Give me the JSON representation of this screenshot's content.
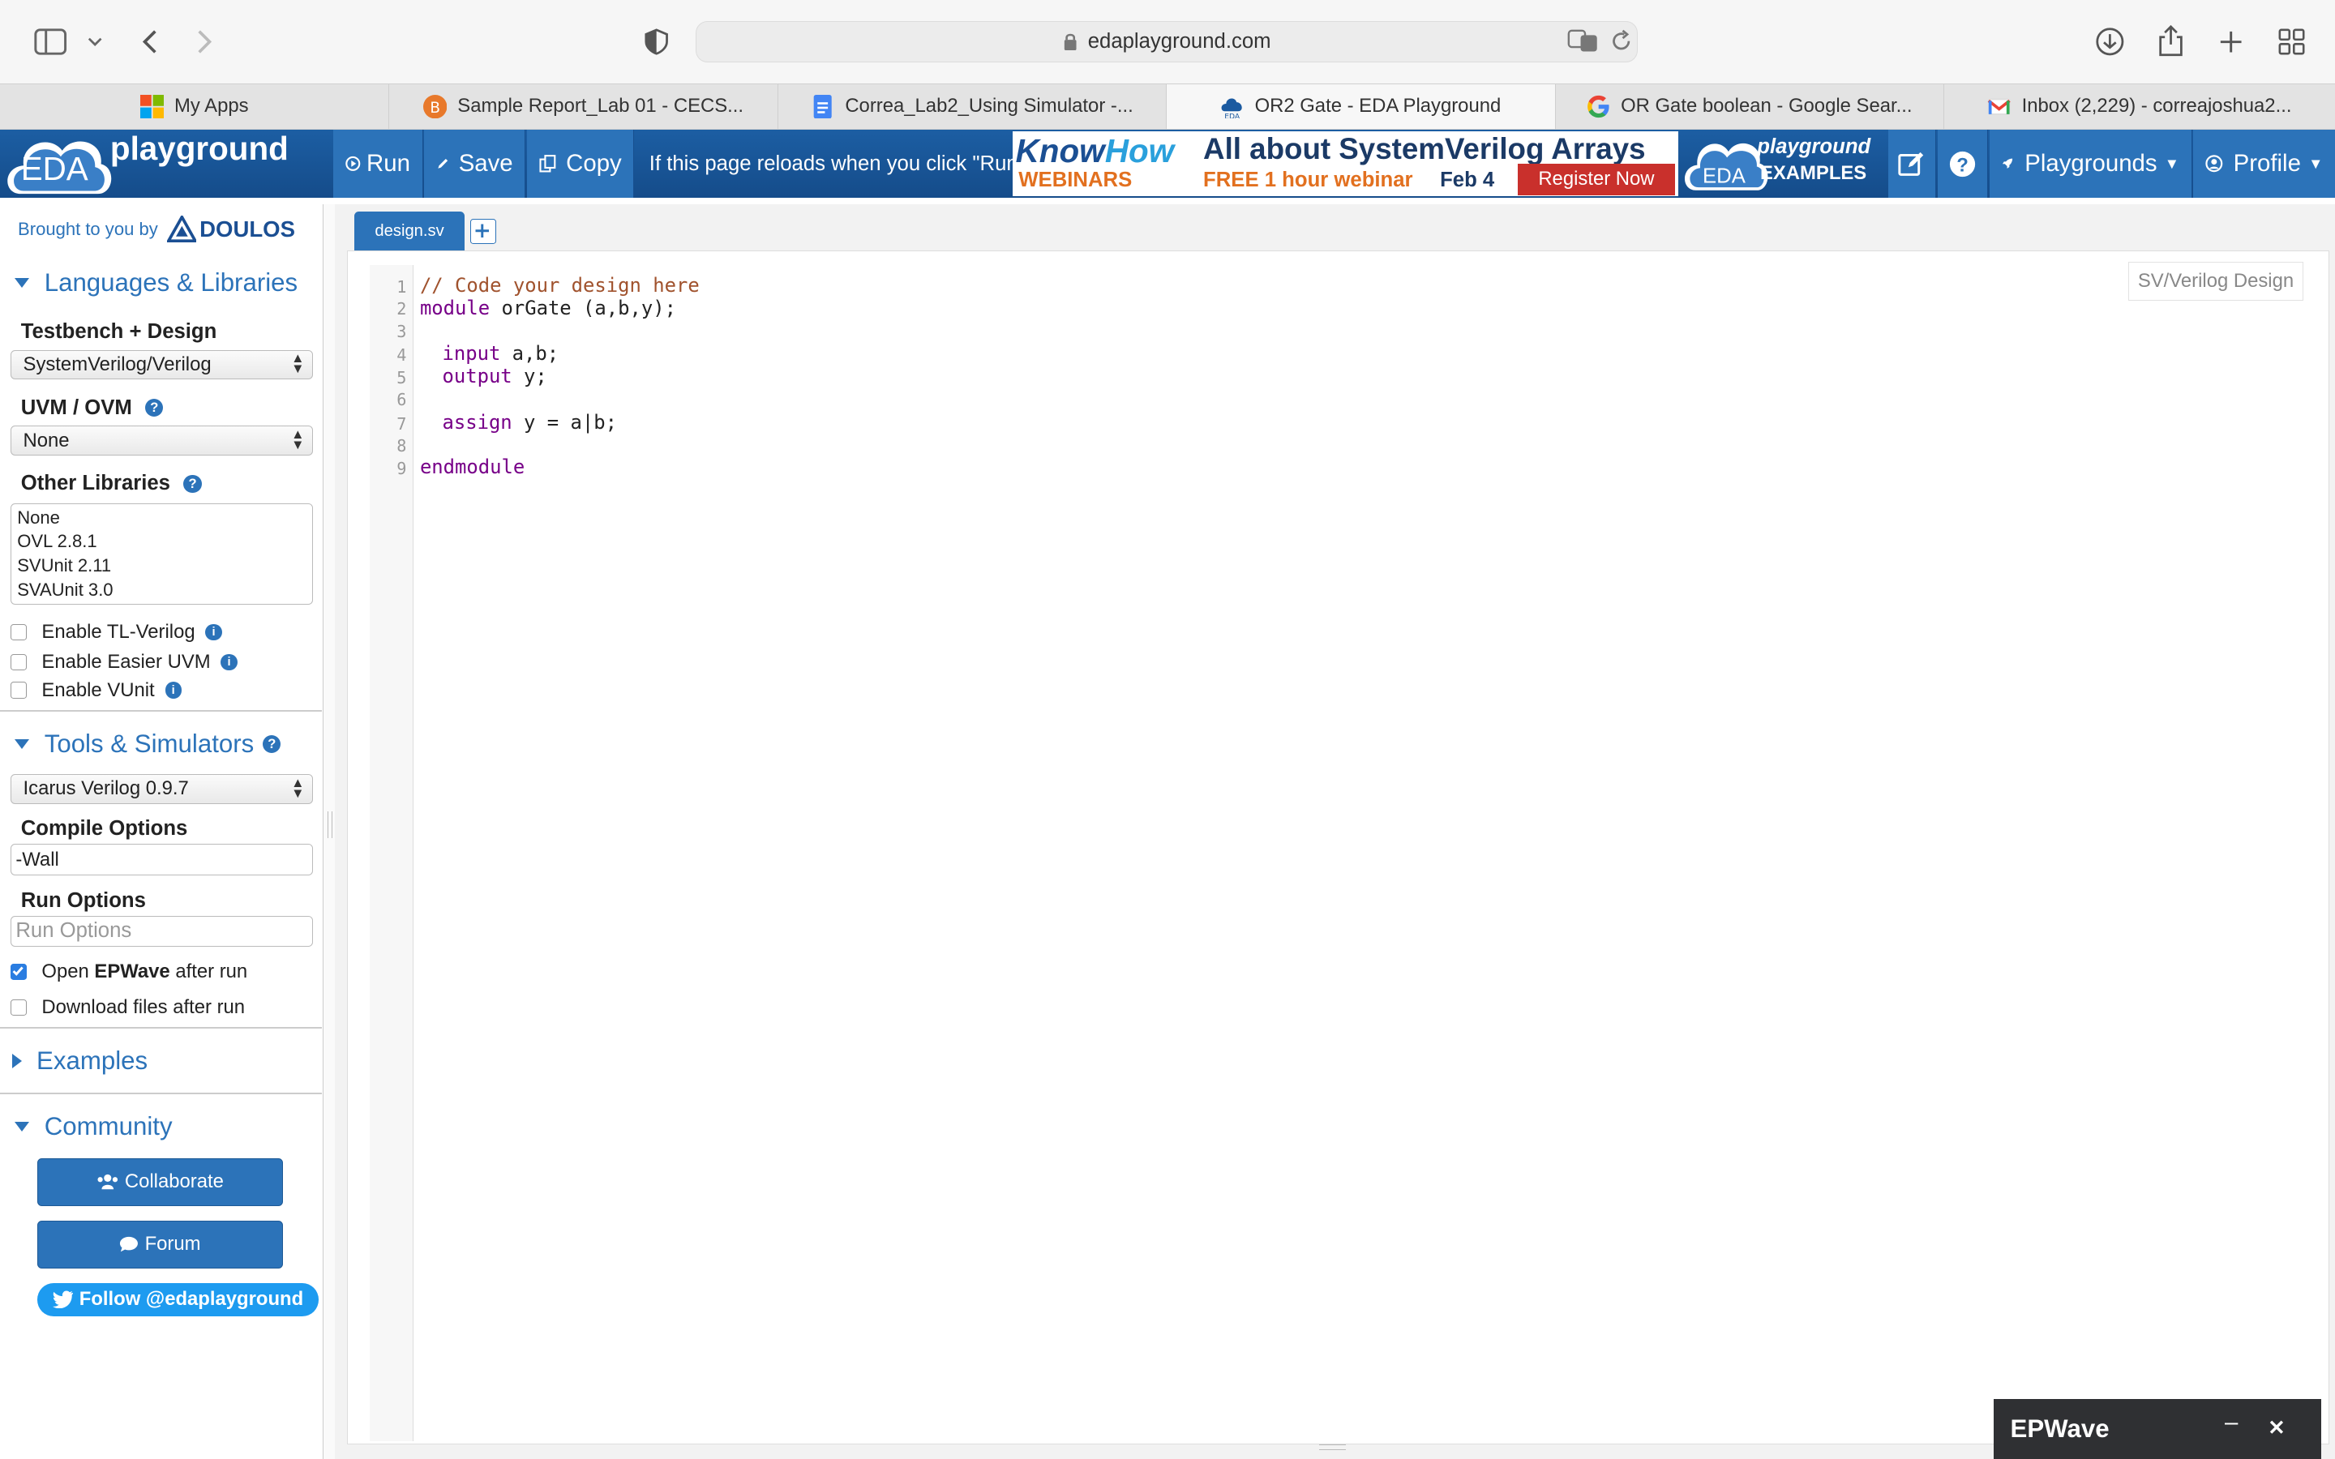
{
  "browser": {
    "url": "edaplayground.com",
    "tabs": [
      {
        "label": "My Apps",
        "active": false
      },
      {
        "label": "Sample Report_Lab 01 - CECS...",
        "active": false
      },
      {
        "label": "Correa_Lab2_Using Simulator -...",
        "active": false
      },
      {
        "label": "OR2 Gate - EDA Playground",
        "active": true
      },
      {
        "label": "OR Gate boolean - Google Sear...",
        "active": false
      },
      {
        "label": "Inbox (2,229) - correajoshua2...",
        "active": false
      }
    ]
  },
  "header": {
    "logo_text": "EDA",
    "logo_sub": "playground",
    "run_label": "Run",
    "save_label": "Save",
    "copy_label": "Copy",
    "notice_text": "If this page reloads when you click \"Run",
    "banner": {
      "brand_know": "Know",
      "brand_how": "How",
      "brand_sub": "WEBINARS",
      "headline": "All about SystemVerilog Arrays",
      "sub": "FREE 1 hour webinar",
      "date": "Feb 4",
      "cta": "Register Now"
    },
    "examples_top": "playground",
    "examples_bottom": "EXAMPLES",
    "playgrounds_label": "Playgrounds",
    "profile_label": "Profile"
  },
  "sidebar": {
    "brought_by": "Brought to you by",
    "doulos": "DOULOS",
    "languages_title": "Languages & Libraries",
    "testbench_label": "Testbench + Design",
    "testbench_value": "SystemVerilog/Verilog",
    "uvm_label": "UVM / OVM",
    "uvm_value": "None",
    "other_libs_label": "Other Libraries",
    "other_libs": [
      "None",
      "OVL 2.8.1",
      "SVUnit 2.11",
      "SVAUnit 3.0"
    ],
    "enable_tl": "Enable TL-Verilog",
    "enable_easier": "Enable Easier UVM",
    "enable_vunit": "Enable VUnit",
    "tools_title": "Tools & Simulators",
    "simulator_value": "Icarus Verilog 0.9.7",
    "compile_label": "Compile Options",
    "compile_value": "-Wall",
    "run_options_label": "Run Options",
    "run_options_placeholder": "Run Options",
    "open_epwave_pre": "Open",
    "open_epwave_bold": "EPWave",
    "open_epwave_post": "after run",
    "download_files": "Download files after run",
    "examples_title": "Examples",
    "community_title": "Community",
    "collaborate": "Collaborate",
    "forum": "Forum",
    "follow": "Follow @edaplayground"
  },
  "editor": {
    "tab_label": "design.sv",
    "mode_label": "SV/Verilog Design",
    "line_numbers": [
      "1",
      "2",
      "3",
      "4",
      "5",
      "6",
      "7",
      "8",
      "9"
    ],
    "lines": {
      "l1": "// Code your design here",
      "l2_kw": "module",
      "l2_rest": " orGate (a,b,y);",
      "l4_kw": "input",
      "l4_rest": " a,b;",
      "l5_kw": "output",
      "l5_rest": " y;",
      "l7_kw": "assign",
      "l7_rest": " y = a|b;",
      "l9_kw": "endmodule"
    }
  },
  "epwave": {
    "title": "EPWave",
    "minimize": "–",
    "close": "✕"
  }
}
